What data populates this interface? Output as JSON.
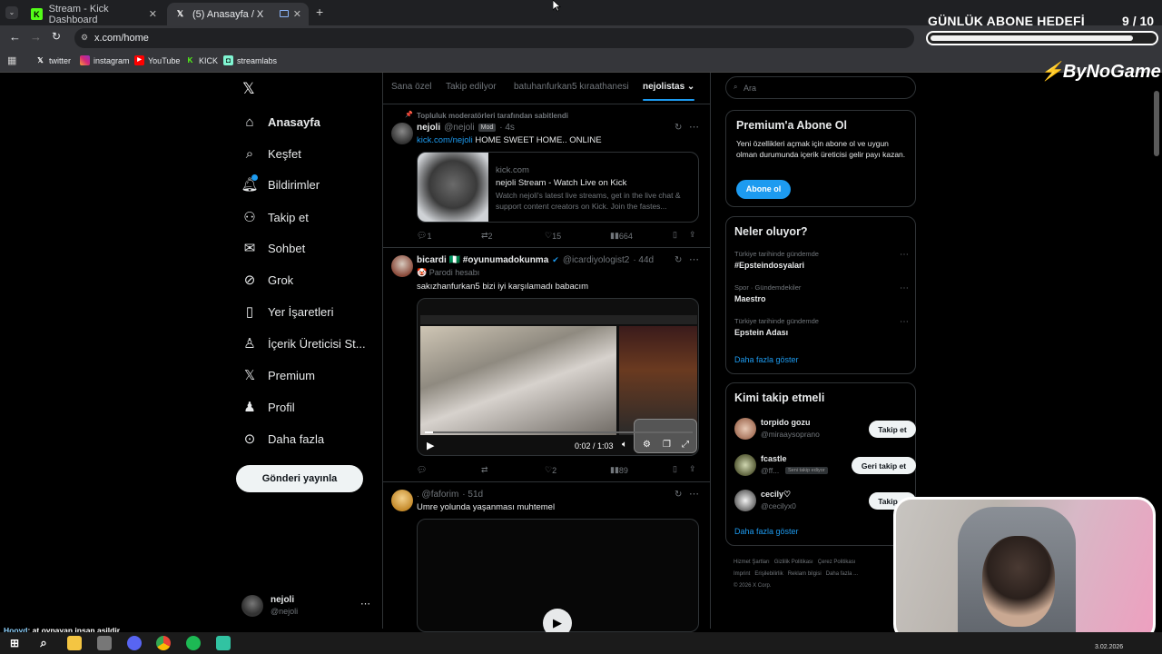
{
  "browser": {
    "tabs": [
      {
        "label": "Stream - Kick Dashboard",
        "active": false
      },
      {
        "label": "(5) Anasayfa / X",
        "active": true
      }
    ],
    "url": "x.com/home",
    "bookmarks": [
      "twitter",
      "instagram",
      "YouTube",
      "KICK",
      "streamlabs"
    ]
  },
  "overlay": {
    "goal_title": "GÜNLÜK ABONE HEDEFİ",
    "goal_current": "9",
    "goal_total": "/ 10",
    "goal_progress": 0.9,
    "brand": "ByNoGame"
  },
  "sidebar": {
    "items": [
      {
        "label": "Anasayfa",
        "icon": "home-icon"
      },
      {
        "label": "Keşfet",
        "icon": "search-icon"
      },
      {
        "label": "Bildirimler",
        "icon": "bell-icon"
      },
      {
        "label": "Takip et",
        "icon": "person-add-icon"
      },
      {
        "label": "Sohbet",
        "icon": "mail-icon"
      },
      {
        "label": "Grok",
        "icon": "grok-icon"
      },
      {
        "label": "Yer İşaretleri",
        "icon": "bookmark-icon"
      },
      {
        "label": "İçerik Üreticisi St...",
        "icon": "creator-icon"
      },
      {
        "label": "Premium",
        "icon": "x-logo-icon"
      },
      {
        "label": "Profil",
        "icon": "profile-icon"
      },
      {
        "label": "Daha fazla",
        "icon": "more-circle-icon"
      }
    ],
    "post_button": "Gönderi yayınla",
    "account": {
      "name": "nejoli",
      "handle": "@nejoli"
    }
  },
  "feed": {
    "tabs": [
      "Sana özel",
      "Takip edilyor",
      "batuhanfurkan5 kıraathanesi",
      "nejolistas"
    ],
    "posts": [
      {
        "pinned_note": "Topluluk moderatörleri tarafından sabitlendi",
        "name": "nejoli",
        "handle": "@nejoli",
        "badge": "Mod",
        "time": "· 4s",
        "link_text": "kick.com/nejoli",
        "text": "HOME SWEET HOME.. ONLINE",
        "card": {
          "domain": "kick.com",
          "title": "nejoli Stream - Watch Live on Kick",
          "desc": "Watch nejoli's latest live streams, get in the live chat & support content creators on Kick. Join the fastes..."
        },
        "replies": "1",
        "reposts": "2",
        "likes": "15",
        "views": "664"
      },
      {
        "name": "bicardi 🇳🇬 #oyunumadokunma",
        "handle": "@icardiyologist2",
        "time": "· 44d",
        "sub": "🤡 Parodi hesabı",
        "text": "sakızhanfurkan5 bizi iyi karşılamadı babacım",
        "video_time": "0:02 / 1:03",
        "replies": "",
        "reposts": "",
        "likes": "2",
        "views": "89"
      },
      {
        "name": "",
        "handle": ". @faforim",
        "time": "· 51d",
        "text": "Umre yolunda yaşanması muhtemel"
      }
    ]
  },
  "right": {
    "search_placeholder": "Ara",
    "premium": {
      "title": "Premium'a Abone Ol",
      "text": "Yeni özellikleri açmak için abone ol ve uygun olman durumunda içerik üreticisi gelir payı kazan.",
      "button": "Abone ol"
    },
    "trends": {
      "title": "Neler oluyor?",
      "items": [
        {
          "cat": "Türkiye tarihinde gündemde",
          "name": "#Epsteindosyalari"
        },
        {
          "cat": "Spor · Gündemdekiler",
          "name": "Maestro"
        },
        {
          "cat": "Türkiye tarihinde gündemde",
          "name": "Epstein Adası"
        }
      ],
      "more": "Daha fazla göster"
    },
    "who_to_follow": {
      "title": "Kimi takip etmeli",
      "users": [
        {
          "name": "torpido gozu",
          "handle": "@miraaysoprano",
          "button": "Takip et"
        },
        {
          "name": "fcastle",
          "handle": "@ff...",
          "tag": "Seni takip ediyor",
          "button": "Geri takip et"
        },
        {
          "name": "cecily♡",
          "handle": "@cecilyx0",
          "button": "Takip et"
        }
      ],
      "more": "Daha fazla göster"
    },
    "footer": [
      "Hizmet Şartları",
      "Gizlilik Politikası",
      "Çerez Politikası",
      "Imprint",
      "Erişilebilirlik",
      "Reklam bilgisi",
      "Daha fazla ...",
      "© 2026 X Corp."
    ]
  },
  "chat": {
    "user": "Hooyd",
    "message": ": at oynayan insan asildir"
  },
  "taskbar": {
    "date": "3.02.2026"
  }
}
